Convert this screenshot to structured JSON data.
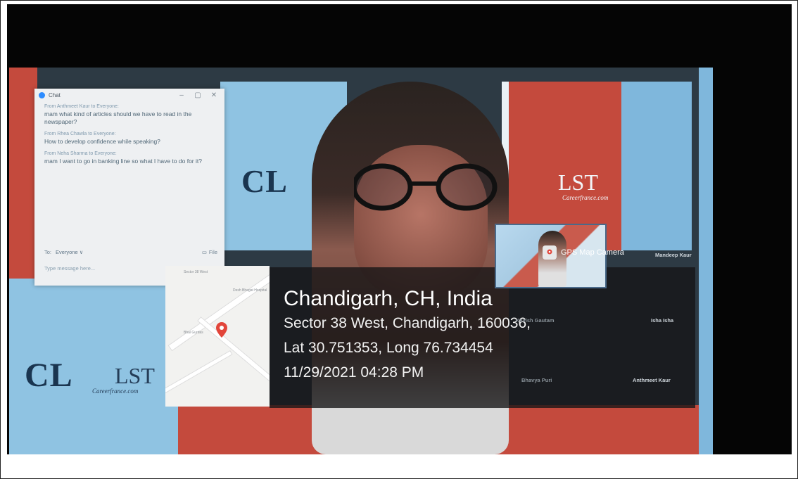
{
  "chat": {
    "title": "Chat",
    "messages": [
      {
        "from": "From Anthmeet Kaur to Everyone:",
        "text": "mam what kind of articles should we have to read in the newspaper?"
      },
      {
        "from": "From Rhea Chawla to Everyone:",
        "text": "How to develop confidence while speaking?"
      },
      {
        "from": "From Neha Sharma to Everyone:",
        "text": "mam I want to go in banking line so what I have to do for it?"
      }
    ],
    "to_label": "To:",
    "to_value": "Everyone ∨",
    "file_label": "File",
    "input_placeholder": "Type message here..."
  },
  "map": {
    "labels": [
      "Sector 38 West",
      "Desh Bhagat Hospital",
      "Bhai Gurdas"
    ]
  },
  "gps": {
    "app_name": "GPS Map Camera",
    "city": "Chandigarh, CH, India",
    "address": "Sector 38 West, Chandigarh, 160036,",
    "coords": "Lat 30.751353, Long 76.734454",
    "datetime": "11/29/2021 04:28 PM"
  },
  "participants": [
    "Mandeep Kaur",
    "Kavish Gautam",
    "Isha Isha",
    "Bhavya Puri",
    "Anthmeet Kaur"
  ],
  "backdrop": {
    "brand_cl": "CL",
    "brand_lst": "LST",
    "brand_sub": "Careerfrance.com"
  },
  "colors": {
    "backdrop_red": "#c44a3d",
    "backdrop_blue": "#8fc3e2",
    "pin_red": "#e2453a",
    "zoom_blue": "#2d8cff"
  }
}
